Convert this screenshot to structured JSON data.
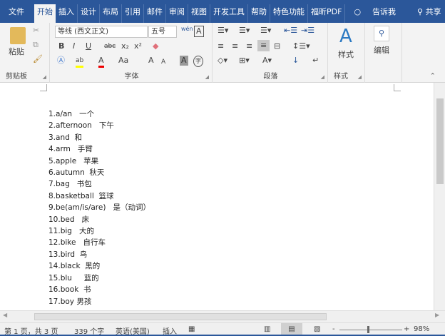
{
  "tabs": [
    "文件",
    "开始",
    "插入",
    "设计",
    "布局",
    "引用",
    "邮件",
    "审阅",
    "视图",
    "开发工具",
    "帮助",
    "特色功能",
    "福昕PDF"
  ],
  "tell_me": "告诉我",
  "share": "共享",
  "ribbon": {
    "clipboard": {
      "label": "剪贴板",
      "paste": "粘贴"
    },
    "font": {
      "label": "字体",
      "font_name": "等线 (西文正文)",
      "font_size": "五号",
      "bold": "B",
      "italic": "I",
      "underline": "U",
      "strike": "abc",
      "sub": "x₂",
      "sup": "x²",
      "case": "Aa",
      "grow": "A",
      "shrink": "A",
      "font_color": "A",
      "highlight": "ab",
      "phonetic": "wén",
      "border": "A",
      "circle": "字"
    },
    "paragraph": {
      "label": "段落"
    },
    "styles": {
      "label": "样式",
      "button": "样式"
    },
    "editing": {
      "button": "编辑"
    }
  },
  "document": {
    "lines": [
      "1.a/an   一个",
      "2.afternoon   下午",
      "3.and  和",
      "4.arm   手臂",
      "5.apple   苹果",
      "6.autumn  秋天",
      "7.bag   书包",
      "8.basketball  篮球",
      "9.be(am/is/are)   是（动词）",
      "10.bed   床",
      "11.big   大的",
      "12.bike   自行车",
      "13.bird  鸟",
      "14.black  黑的",
      "15.blu     蓝的",
      "16.book  书",
      "17.boy 男孩"
    ]
  },
  "status": {
    "page": "第 1 页，共 3 页",
    "words": "339 个字",
    "language": "英语(美国)",
    "mode": "插入",
    "zoom": "98%"
  }
}
